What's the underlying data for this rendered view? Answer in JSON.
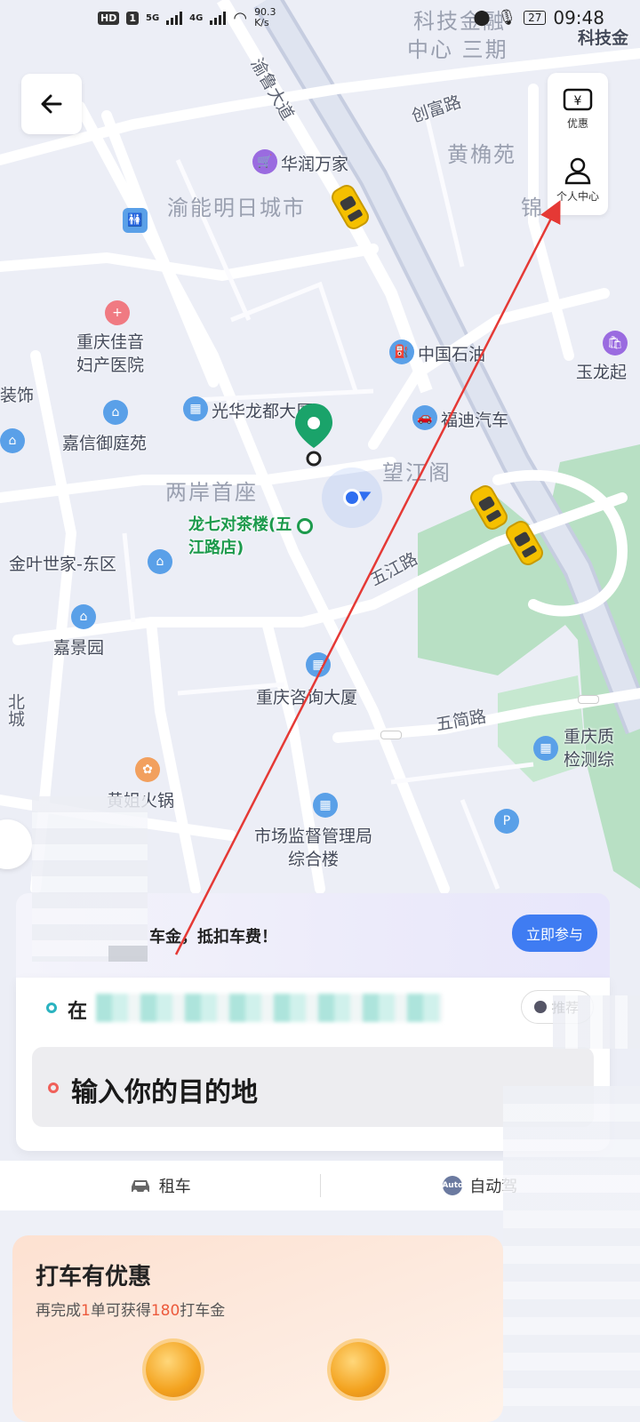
{
  "status_bar": {
    "hd_label": "HD",
    "sim": "1",
    "network_1": "5G",
    "network_2": "4G",
    "speed": "90.3",
    "speed_unit": "K/s",
    "battery": "27",
    "time": "09:48"
  },
  "map": {
    "labels": {
      "tech_finance": "科技金融",
      "center_phase3": "中心 三期",
      "tech_finance_right": "科技金",
      "yulu_road": "渝鲁大道",
      "chuangfu_road": "创富路",
      "huangjiao_yuan": "黄桷苑",
      "crv_mall": "华润万家",
      "yuneng_city": "渝能明日城市",
      "jin": "锦",
      "cq_hospital": "重庆佳音\n妇产医院",
      "sinopec": "中国石油",
      "yulong": "玉龙起",
      "zhuangshi": "装饰",
      "guanghua": "光华龙都大厦",
      "ford": "福迪汽车",
      "jiaxin": "嘉信御庭苑",
      "wangjiang": "望江阁",
      "liangan": "两岸首座",
      "longqi": "龙七对茶楼(五江路店)",
      "jinye": "金叶世家-东区",
      "wujiang_road": "五江路",
      "jiajing": "嘉景园",
      "consult": "重庆咨询大厦",
      "wujian_road": "五简路",
      "cq_quality": "重庆质\n检测综",
      "beicheng": "北城",
      "huangjie": "黄姐火锅",
      "market_reg": "市场监督管理局\n综合楼"
    }
  },
  "top_bar": {
    "back_icon": "back-arrow-icon",
    "coupon_label": "优惠",
    "coupon_icon": "yen-ticket-icon",
    "profile_label": "个人中心",
    "profile_icon": "person-icon"
  },
  "promo": {
    "text": "车金，抵扣车费！",
    "join_button": "立即参与"
  },
  "trip": {
    "origin_text": "在",
    "recommend_button": "推荐",
    "destination_placeholder": "输入你的目的地"
  },
  "services": [
    {
      "label": "租车",
      "icon": "car-icon"
    },
    {
      "label": "自动驾",
      "icon": "auto-icon",
      "badge": "Auto"
    }
  ],
  "offer": {
    "title": "打车有优惠",
    "sub_prefix": "再完成",
    "sub_count": "1",
    "sub_mid": "单可获得",
    "sub_amount": "180",
    "sub_suffix": "打车金"
  },
  "colors": {
    "accent_blue": "#3f7cf2",
    "origin_dot": "#2bb3c0",
    "dest_dot": "#f0605a",
    "annotation_red": "#e53935",
    "map_marker_green": "#1c9a4c"
  }
}
